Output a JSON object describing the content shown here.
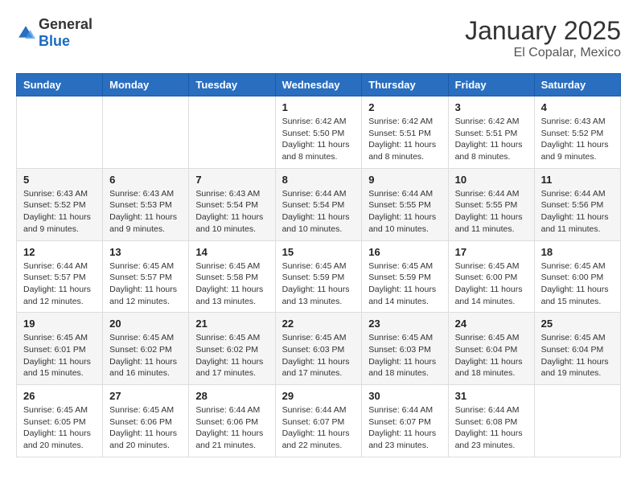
{
  "logo": {
    "text_general": "General",
    "text_blue": "Blue"
  },
  "header": {
    "month": "January 2025",
    "location": "El Copalar, Mexico"
  },
  "weekdays": [
    "Sunday",
    "Monday",
    "Tuesday",
    "Wednesday",
    "Thursday",
    "Friday",
    "Saturday"
  ],
  "weeks": [
    [
      {
        "day": "",
        "sunrise": "",
        "sunset": "",
        "daylight": ""
      },
      {
        "day": "",
        "sunrise": "",
        "sunset": "",
        "daylight": ""
      },
      {
        "day": "",
        "sunrise": "",
        "sunset": "",
        "daylight": ""
      },
      {
        "day": "1",
        "sunrise": "Sunrise: 6:42 AM",
        "sunset": "Sunset: 5:50 PM",
        "daylight": "Daylight: 11 hours and 8 minutes."
      },
      {
        "day": "2",
        "sunrise": "Sunrise: 6:42 AM",
        "sunset": "Sunset: 5:51 PM",
        "daylight": "Daylight: 11 hours and 8 minutes."
      },
      {
        "day": "3",
        "sunrise": "Sunrise: 6:42 AM",
        "sunset": "Sunset: 5:51 PM",
        "daylight": "Daylight: 11 hours and 8 minutes."
      },
      {
        "day": "4",
        "sunrise": "Sunrise: 6:43 AM",
        "sunset": "Sunset: 5:52 PM",
        "daylight": "Daylight: 11 hours and 9 minutes."
      }
    ],
    [
      {
        "day": "5",
        "sunrise": "Sunrise: 6:43 AM",
        "sunset": "Sunset: 5:52 PM",
        "daylight": "Daylight: 11 hours and 9 minutes."
      },
      {
        "day": "6",
        "sunrise": "Sunrise: 6:43 AM",
        "sunset": "Sunset: 5:53 PM",
        "daylight": "Daylight: 11 hours and 9 minutes."
      },
      {
        "day": "7",
        "sunrise": "Sunrise: 6:43 AM",
        "sunset": "Sunset: 5:54 PM",
        "daylight": "Daylight: 11 hours and 10 minutes."
      },
      {
        "day": "8",
        "sunrise": "Sunrise: 6:44 AM",
        "sunset": "Sunset: 5:54 PM",
        "daylight": "Daylight: 11 hours and 10 minutes."
      },
      {
        "day": "9",
        "sunrise": "Sunrise: 6:44 AM",
        "sunset": "Sunset: 5:55 PM",
        "daylight": "Daylight: 11 hours and 10 minutes."
      },
      {
        "day": "10",
        "sunrise": "Sunrise: 6:44 AM",
        "sunset": "Sunset: 5:55 PM",
        "daylight": "Daylight: 11 hours and 11 minutes."
      },
      {
        "day": "11",
        "sunrise": "Sunrise: 6:44 AM",
        "sunset": "Sunset: 5:56 PM",
        "daylight": "Daylight: 11 hours and 11 minutes."
      }
    ],
    [
      {
        "day": "12",
        "sunrise": "Sunrise: 6:44 AM",
        "sunset": "Sunset: 5:57 PM",
        "daylight": "Daylight: 11 hours and 12 minutes."
      },
      {
        "day": "13",
        "sunrise": "Sunrise: 6:45 AM",
        "sunset": "Sunset: 5:57 PM",
        "daylight": "Daylight: 11 hours and 12 minutes."
      },
      {
        "day": "14",
        "sunrise": "Sunrise: 6:45 AM",
        "sunset": "Sunset: 5:58 PM",
        "daylight": "Daylight: 11 hours and 13 minutes."
      },
      {
        "day": "15",
        "sunrise": "Sunrise: 6:45 AM",
        "sunset": "Sunset: 5:59 PM",
        "daylight": "Daylight: 11 hours and 13 minutes."
      },
      {
        "day": "16",
        "sunrise": "Sunrise: 6:45 AM",
        "sunset": "Sunset: 5:59 PM",
        "daylight": "Daylight: 11 hours and 14 minutes."
      },
      {
        "day": "17",
        "sunrise": "Sunrise: 6:45 AM",
        "sunset": "Sunset: 6:00 PM",
        "daylight": "Daylight: 11 hours and 14 minutes."
      },
      {
        "day": "18",
        "sunrise": "Sunrise: 6:45 AM",
        "sunset": "Sunset: 6:00 PM",
        "daylight": "Daylight: 11 hours and 15 minutes."
      }
    ],
    [
      {
        "day": "19",
        "sunrise": "Sunrise: 6:45 AM",
        "sunset": "Sunset: 6:01 PM",
        "daylight": "Daylight: 11 hours and 15 minutes."
      },
      {
        "day": "20",
        "sunrise": "Sunrise: 6:45 AM",
        "sunset": "Sunset: 6:02 PM",
        "daylight": "Daylight: 11 hours and 16 minutes."
      },
      {
        "day": "21",
        "sunrise": "Sunrise: 6:45 AM",
        "sunset": "Sunset: 6:02 PM",
        "daylight": "Daylight: 11 hours and 17 minutes."
      },
      {
        "day": "22",
        "sunrise": "Sunrise: 6:45 AM",
        "sunset": "Sunset: 6:03 PM",
        "daylight": "Daylight: 11 hours and 17 minutes."
      },
      {
        "day": "23",
        "sunrise": "Sunrise: 6:45 AM",
        "sunset": "Sunset: 6:03 PM",
        "daylight": "Daylight: 11 hours and 18 minutes."
      },
      {
        "day": "24",
        "sunrise": "Sunrise: 6:45 AM",
        "sunset": "Sunset: 6:04 PM",
        "daylight": "Daylight: 11 hours and 18 minutes."
      },
      {
        "day": "25",
        "sunrise": "Sunrise: 6:45 AM",
        "sunset": "Sunset: 6:04 PM",
        "daylight": "Daylight: 11 hours and 19 minutes."
      }
    ],
    [
      {
        "day": "26",
        "sunrise": "Sunrise: 6:45 AM",
        "sunset": "Sunset: 6:05 PM",
        "daylight": "Daylight: 11 hours and 20 minutes."
      },
      {
        "day": "27",
        "sunrise": "Sunrise: 6:45 AM",
        "sunset": "Sunset: 6:06 PM",
        "daylight": "Daylight: 11 hours and 20 minutes."
      },
      {
        "day": "28",
        "sunrise": "Sunrise: 6:44 AM",
        "sunset": "Sunset: 6:06 PM",
        "daylight": "Daylight: 11 hours and 21 minutes."
      },
      {
        "day": "29",
        "sunrise": "Sunrise: 6:44 AM",
        "sunset": "Sunset: 6:07 PM",
        "daylight": "Daylight: 11 hours and 22 minutes."
      },
      {
        "day": "30",
        "sunrise": "Sunrise: 6:44 AM",
        "sunset": "Sunset: 6:07 PM",
        "daylight": "Daylight: 11 hours and 23 minutes."
      },
      {
        "day": "31",
        "sunrise": "Sunrise: 6:44 AM",
        "sunset": "Sunset: 6:08 PM",
        "daylight": "Daylight: 11 hours and 23 minutes."
      },
      {
        "day": "",
        "sunrise": "",
        "sunset": "",
        "daylight": ""
      }
    ]
  ]
}
